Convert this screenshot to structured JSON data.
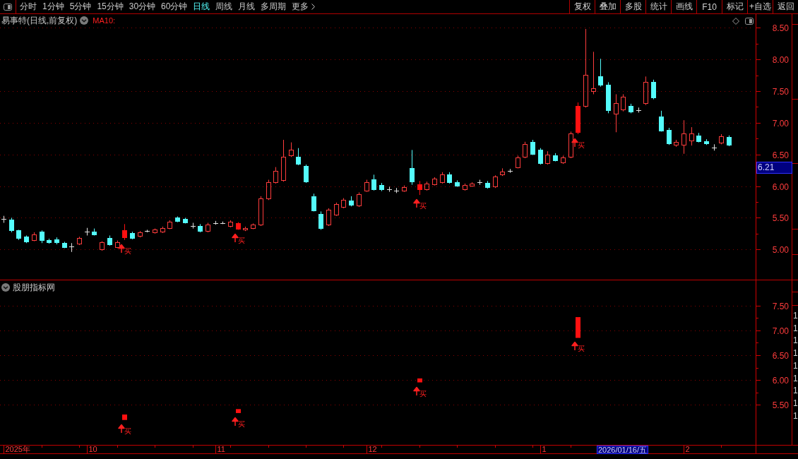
{
  "toolbar": {
    "periods": [
      {
        "kind": "period",
        "label": "分时",
        "selected": false
      },
      {
        "kind": "period",
        "label": "1分钟",
        "selected": false
      },
      {
        "kind": "period",
        "label": "5分钟",
        "selected": false
      },
      {
        "kind": "period",
        "label": "15分钟",
        "selected": false
      },
      {
        "kind": "period",
        "label": "30分钟",
        "selected": false
      },
      {
        "kind": "period",
        "label": "60分钟",
        "selected": false
      },
      {
        "kind": "period",
        "label": "日线",
        "selected": true
      },
      {
        "kind": "period",
        "label": "周线",
        "selected": false
      },
      {
        "kind": "period",
        "label": "月线",
        "selected": false
      },
      {
        "kind": "period",
        "label": "多周期",
        "selected": false
      },
      {
        "kind": "more",
        "label": "更多",
        "selected": false
      }
    ],
    "actions": [
      "复权",
      "叠加",
      "多股",
      "统计",
      "画线",
      "F10",
      "标记",
      "+自选",
      "返回"
    ]
  },
  "main_panel": {
    "title": "易事特(日线,前复权)",
    "indicator": "MA10:",
    "price_axis_labels": [
      "8.50",
      "8.00",
      "7.50",
      "7.00",
      "6.50",
      "6.00",
      "5.50",
      "5.00"
    ],
    "signal_labels": [
      "买",
      "买",
      "买",
      "买"
    ]
  },
  "sub_panel": {
    "title": "股朋指标网",
    "price_axis_labels": [
      "7.50",
      "7.00",
      "6.50",
      "6.00",
      "5.50"
    ],
    "signal_labels": [
      "买",
      "买",
      "买",
      "买"
    ]
  },
  "crosshair": {
    "price_label": "6.21",
    "date_label": "2026/01/16/五"
  },
  "time_axis": {
    "labels": [
      "2025年",
      "10",
      "11",
      "12",
      "1",
      "2"
    ]
  },
  "side_strip": {
    "lower_column": [
      "1",
      "1",
      "1",
      "1",
      "1",
      "1",
      "1",
      "1",
      "1"
    ]
  }
}
